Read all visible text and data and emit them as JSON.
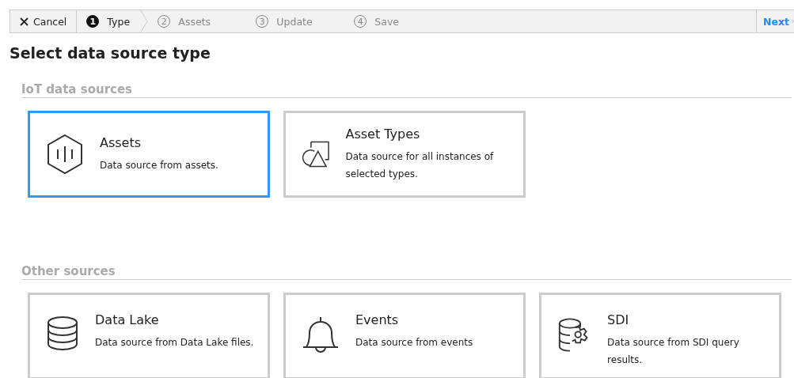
{
  "toolbar": {
    "cancel": "Cancel",
    "steps": [
      {
        "number": "1",
        "label": "Type",
        "selected": true
      },
      {
        "number": "2",
        "label": "Assets",
        "selected": false
      },
      {
        "number": "3",
        "label": "Update",
        "selected": false
      },
      {
        "number": "4",
        "label": "Save",
        "selected": false
      }
    ],
    "next": "Next"
  },
  "title": "Select data source type",
  "sections": [
    {
      "heading": "IoT data sources",
      "cards": [
        {
          "kind": "asset",
          "title": "Assets",
          "description": "Data source from assets.",
          "selected": true
        },
        {
          "kind": "types",
          "title": "Asset Types",
          "description": "Data source for all instances of selected types.",
          "selected": false
        }
      ]
    },
    {
      "heading": "Other sources",
      "cards": [
        {
          "kind": "lake",
          "title": "Data Lake",
          "description": "Data source from Data Lake files.",
          "selected": false
        },
        {
          "kind": "events",
          "title": "Events",
          "description": "Data source from events",
          "selected": false
        },
        {
          "kind": "sdi",
          "title": "SDI",
          "description": "Data source from SDI query results.",
          "selected": false
        }
      ]
    }
  ]
}
